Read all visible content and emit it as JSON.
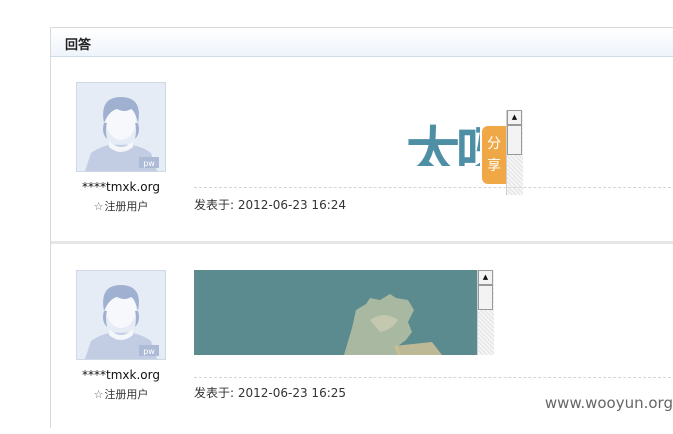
{
  "section": {
    "title": "回答"
  },
  "posts": [
    {
      "username": "****tmxk.org",
      "role": "注册用户",
      "avatar_badge": "pw",
      "image_text": "太呀",
      "share_label_1": "分",
      "share_label_2": "享",
      "posted_label": "发表于:",
      "posted_time": "2012-06-23 16:24"
    },
    {
      "username": "****tmxk.org",
      "role": "注册用户",
      "avatar_badge": "pw",
      "posted_label": "发表于:",
      "posted_time": "2012-06-23 16:25"
    }
  ],
  "icons": {
    "role": "star-outline-icon",
    "scroll_up": "arrow-up-icon"
  },
  "colors": {
    "share_tab": "#f0a846",
    "header_bg": "#eef4fb",
    "image_teal": "#5b8b8f"
  },
  "watermark": "www.wooyun.org"
}
